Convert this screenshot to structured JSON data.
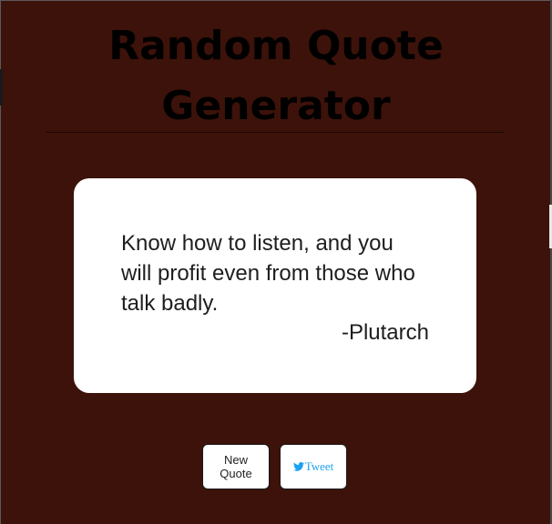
{
  "header": {
    "title": "Random Quote Generator"
  },
  "quote": {
    "text": "Know how to listen, and you will profit even from those who talk badly.",
    "author": "-Plutarch"
  },
  "buttons": {
    "new_quote_label": "New Quote",
    "tweet_label": "Tweet",
    "tweet_icon": "twitter-bird-icon"
  },
  "colors": {
    "background": "#3d120a",
    "card": "#ffffff",
    "title": "#000000",
    "tweet": "#1da1f2"
  }
}
